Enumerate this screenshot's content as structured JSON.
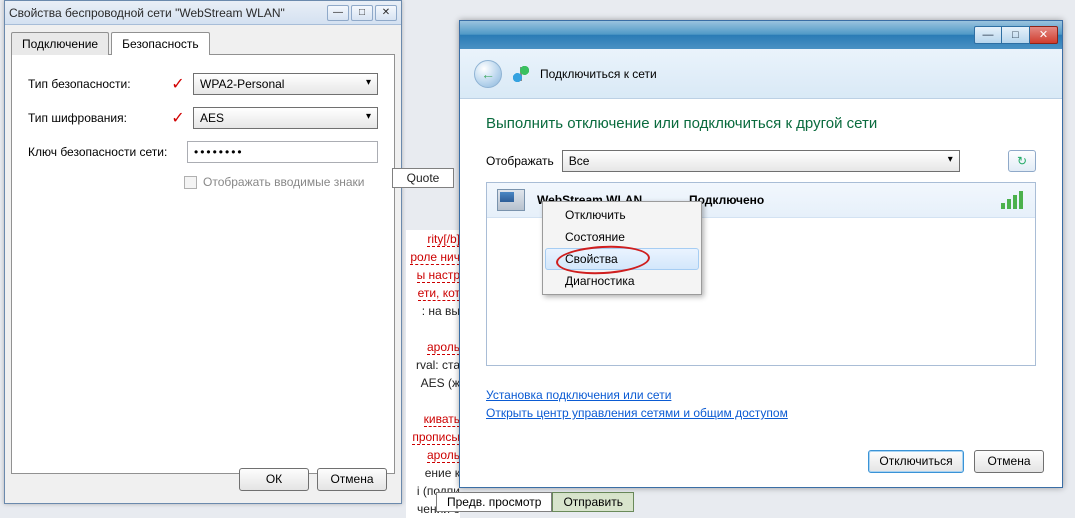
{
  "props": {
    "title": "Свойства беспроводной сети \"WebStream WLAN\"",
    "tabs": {
      "connection": "Подключение",
      "security": "Безопасность"
    },
    "labels": {
      "sec_type": "Тип безопасности:",
      "enc_type": "Тип шифрования:",
      "key": "Ключ безопасности сети:"
    },
    "values": {
      "sec_type": "WPA2-Personal",
      "enc_type": "AES",
      "key": "••••••••"
    },
    "show_chars": "Отображать вводимые знаки",
    "ok": "ОК",
    "cancel": "Отмена"
  },
  "frag": {
    "quote": "Quote",
    "lines": [
      "rity[/b]",
      "роле нич",
      "ы настр",
      "ети, кот",
      ": на вы",
      "",
      "ароль",
      "rval: ста",
      "AES (ж",
      "",
      "кивать",
      "прописы",
      "ароль",
      "ение к",
      "i (подпи",
      "чении о"
    ],
    "preview": "Предв. просмотр",
    "send": "Отправить"
  },
  "conn": {
    "head": "Подключиться к сети",
    "h1": "Выполнить отключение или подключиться к другой сети",
    "filter_label": "Отображать",
    "filter_value": "Все",
    "network": {
      "name": "WebStream WLAN",
      "status": "Подключено"
    },
    "ctx": [
      "Отключить",
      "Состояние",
      "Свойства",
      "Диагностика"
    ],
    "links": {
      "setup": "Установка подключения или сети",
      "center": "Открыть центр управления сетями и общим доступом"
    },
    "disconnect": "Отключиться",
    "cancel": "Отмена"
  }
}
